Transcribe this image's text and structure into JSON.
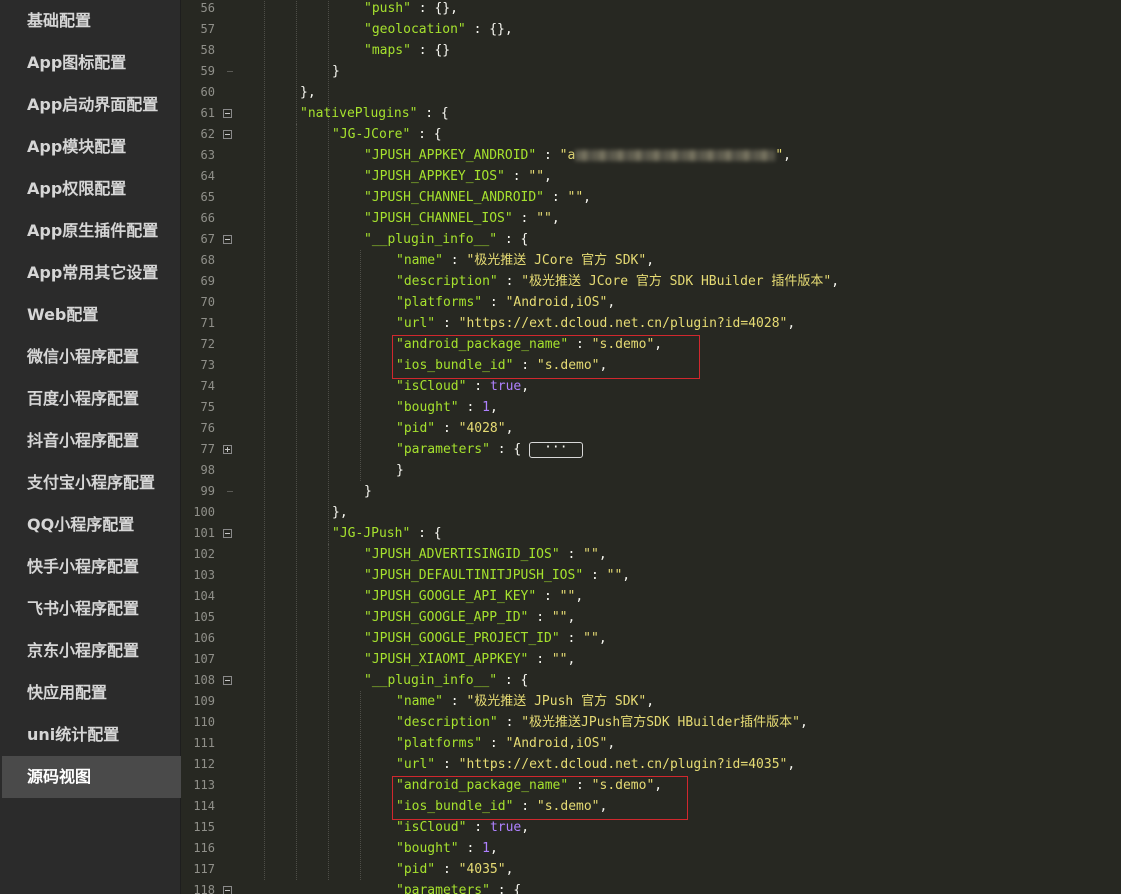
{
  "sidebar": {
    "items": [
      {
        "label": "基础配置"
      },
      {
        "label": "App图标配置"
      },
      {
        "label": "App启动界面配置"
      },
      {
        "label": "App模块配置"
      },
      {
        "label": "App权限配置"
      },
      {
        "label": "App原生插件配置"
      },
      {
        "label": "App常用其它设置"
      },
      {
        "label": "Web配置"
      },
      {
        "label": "微信小程序配置"
      },
      {
        "label": "百度小程序配置"
      },
      {
        "label": "抖音小程序配置"
      },
      {
        "label": "支付宝小程序配置"
      },
      {
        "label": "QQ小程序配置"
      },
      {
        "label": "快手小程序配置"
      },
      {
        "label": "飞书小程序配置"
      },
      {
        "label": "京东小程序配置"
      },
      {
        "label": "快应用配置"
      },
      {
        "label": "uni统计配置"
      },
      {
        "label": "源码视图",
        "active": true
      }
    ]
  },
  "editor": {
    "theme_colors": {
      "key": "#a6e22e",
      "string": "#e6db74",
      "number": "#ae81ff",
      "text": "#f8f8f2",
      "highlight": "#d0282e"
    },
    "lines": [
      {
        "no": "56",
        "indent": 3,
        "tokens": [
          [
            "k",
            "\"push\""
          ],
          [
            "p",
            " : {},"
          ]
        ]
      },
      {
        "no": "57",
        "indent": 3,
        "tokens": [
          [
            "k",
            "\"geolocation\""
          ],
          [
            "p",
            " : {},"
          ]
        ]
      },
      {
        "no": "58",
        "indent": 3,
        "tokens": [
          [
            "k",
            "\"maps\""
          ],
          [
            "p",
            " : {}"
          ]
        ]
      },
      {
        "no": "59",
        "indent": 2,
        "tokens": [
          [
            "p",
            "}"
          ]
        ],
        "fold": "end"
      },
      {
        "no": "60",
        "indent": 1,
        "tokens": [
          [
            "p",
            "},"
          ]
        ]
      },
      {
        "no": "61",
        "indent": 1,
        "tokens": [
          [
            "k",
            "\"nativePlugins\""
          ],
          [
            "p",
            " : {"
          ]
        ],
        "fold": "minus"
      },
      {
        "no": "62",
        "indent": 2,
        "tokens": [
          [
            "k",
            "\"JG-JCore\""
          ],
          [
            "p",
            " : {"
          ]
        ],
        "fold": "minus"
      },
      {
        "no": "63",
        "indent": 3,
        "tokens": [
          [
            "k",
            "\"JPUSH_APPKEY_ANDROID\""
          ],
          [
            "p",
            " : "
          ],
          [
            "s",
            "\"a"
          ],
          [
            "blur",
            ""
          ],
          [
            "s",
            "\""
          ],
          [
            "p",
            ","
          ]
        ]
      },
      {
        "no": "64",
        "indent": 3,
        "tokens": [
          [
            "k",
            "\"JPUSH_APPKEY_IOS\""
          ],
          [
            "p",
            " : "
          ],
          [
            "s",
            "\"\""
          ],
          [
            "p",
            ","
          ]
        ]
      },
      {
        "no": "65",
        "indent": 3,
        "tokens": [
          [
            "k",
            "\"JPUSH_CHANNEL_ANDROID\""
          ],
          [
            "p",
            " : "
          ],
          [
            "s",
            "\"\""
          ],
          [
            "p",
            ","
          ]
        ]
      },
      {
        "no": "66",
        "indent": 3,
        "tokens": [
          [
            "k",
            "\"JPUSH_CHANNEL_IOS\""
          ],
          [
            "p",
            " : "
          ],
          [
            "s",
            "\"\""
          ],
          [
            "p",
            ","
          ]
        ]
      },
      {
        "no": "67",
        "indent": 3,
        "tokens": [
          [
            "k",
            "\"__plugin_info__\""
          ],
          [
            "p",
            " : {"
          ]
        ],
        "fold": "minus"
      },
      {
        "no": "68",
        "indent": 4,
        "tokens": [
          [
            "k",
            "\"name\""
          ],
          [
            "p",
            " : "
          ],
          [
            "s",
            "\"极光推送 JCore 官方 SDK\""
          ],
          [
            "p",
            ","
          ]
        ]
      },
      {
        "no": "69",
        "indent": 4,
        "tokens": [
          [
            "k",
            "\"description\""
          ],
          [
            "p",
            " : "
          ],
          [
            "s",
            "\"极光推送 JCore 官方 SDK HBuilder 插件版本\""
          ],
          [
            "p",
            ","
          ]
        ]
      },
      {
        "no": "70",
        "indent": 4,
        "tokens": [
          [
            "k",
            "\"platforms\""
          ],
          [
            "p",
            " : "
          ],
          [
            "s",
            "\"Android,iOS\""
          ],
          [
            "p",
            ","
          ]
        ]
      },
      {
        "no": "71",
        "indent": 4,
        "tokens": [
          [
            "k",
            "\"url\""
          ],
          [
            "p",
            " : "
          ],
          [
            "s",
            "\"https://ext.dcloud.net.cn/plugin?id=4028\""
          ],
          [
            "p",
            ","
          ]
        ]
      },
      {
        "no": "72",
        "indent": 4,
        "tokens": [
          [
            "k",
            "\"android_package_name\""
          ],
          [
            "p",
            " : "
          ],
          [
            "s",
            "\"s.demo\""
          ],
          [
            "p",
            ","
          ]
        ]
      },
      {
        "no": "73",
        "indent": 4,
        "tokens": [
          [
            "k",
            "\"ios_bundle_id\""
          ],
          [
            "p",
            " : "
          ],
          [
            "s",
            "\"s.demo\""
          ],
          [
            "p",
            ","
          ]
        ]
      },
      {
        "no": "74",
        "indent": 4,
        "tokens": [
          [
            "k",
            "\"isCloud\""
          ],
          [
            "p",
            " : "
          ],
          [
            "n",
            "true"
          ],
          [
            "p",
            ","
          ]
        ]
      },
      {
        "no": "75",
        "indent": 4,
        "tokens": [
          [
            "k",
            "\"bought\""
          ],
          [
            "p",
            " : "
          ],
          [
            "n",
            "1"
          ],
          [
            "p",
            ","
          ]
        ]
      },
      {
        "no": "76",
        "indent": 4,
        "tokens": [
          [
            "k",
            "\"pid\""
          ],
          [
            "p",
            " : "
          ],
          [
            "s",
            "\"4028\""
          ],
          [
            "p",
            ","
          ]
        ]
      },
      {
        "no": "77",
        "indent": 4,
        "tokens": [
          [
            "k",
            "\"parameters\""
          ],
          [
            "p",
            " : { "
          ],
          [
            "folded",
            "···"
          ]
        ],
        "fold": "plus"
      },
      {
        "no": "98",
        "indent": 4,
        "tokens": [
          [
            "p",
            "}"
          ]
        ]
      },
      {
        "no": "99",
        "indent": 3,
        "tokens": [
          [
            "p",
            "}"
          ]
        ],
        "fold": "end"
      },
      {
        "no": "100",
        "indent": 2,
        "tokens": [
          [
            "p",
            "},"
          ]
        ]
      },
      {
        "no": "101",
        "indent": 2,
        "tokens": [
          [
            "k",
            "\"JG-JPush\""
          ],
          [
            "p",
            " : {"
          ]
        ],
        "fold": "minus"
      },
      {
        "no": "102",
        "indent": 3,
        "tokens": [
          [
            "k",
            "\"JPUSH_ADVERTISINGID_IOS\""
          ],
          [
            "p",
            " : "
          ],
          [
            "s",
            "\"\""
          ],
          [
            "p",
            ","
          ]
        ]
      },
      {
        "no": "103",
        "indent": 3,
        "tokens": [
          [
            "k",
            "\"JPUSH_DEFAULTINITJPUSH_IOS\""
          ],
          [
            "p",
            " : "
          ],
          [
            "s",
            "\"\""
          ],
          [
            "p",
            ","
          ]
        ]
      },
      {
        "no": "104",
        "indent": 3,
        "tokens": [
          [
            "k",
            "\"JPUSH_GOOGLE_API_KEY\""
          ],
          [
            "p",
            " : "
          ],
          [
            "s",
            "\"\""
          ],
          [
            "p",
            ","
          ]
        ]
      },
      {
        "no": "105",
        "indent": 3,
        "tokens": [
          [
            "k",
            "\"JPUSH_GOOGLE_APP_ID\""
          ],
          [
            "p",
            " : "
          ],
          [
            "s",
            "\"\""
          ],
          [
            "p",
            ","
          ]
        ]
      },
      {
        "no": "106",
        "indent": 3,
        "tokens": [
          [
            "k",
            "\"JPUSH_GOOGLE_PROJECT_ID\""
          ],
          [
            "p",
            " : "
          ],
          [
            "s",
            "\"\""
          ],
          [
            "p",
            ","
          ]
        ]
      },
      {
        "no": "107",
        "indent": 3,
        "tokens": [
          [
            "k",
            "\"JPUSH_XIAOMI_APPKEY\""
          ],
          [
            "p",
            " : "
          ],
          [
            "s",
            "\"\""
          ],
          [
            "p",
            ","
          ]
        ]
      },
      {
        "no": "108",
        "indent": 3,
        "tokens": [
          [
            "k",
            "\"__plugin_info__\""
          ],
          [
            "p",
            " : {"
          ]
        ],
        "fold": "minus"
      },
      {
        "no": "109",
        "indent": 4,
        "tokens": [
          [
            "k",
            "\"name\""
          ],
          [
            "p",
            " : "
          ],
          [
            "s",
            "\"极光推送 JPush 官方 SDK\""
          ],
          [
            "p",
            ","
          ]
        ]
      },
      {
        "no": "110",
        "indent": 4,
        "tokens": [
          [
            "k",
            "\"description\""
          ],
          [
            "p",
            " : "
          ],
          [
            "s",
            "\"极光推送JPush官方SDK HBuilder插件版本\""
          ],
          [
            "p",
            ","
          ]
        ]
      },
      {
        "no": "111",
        "indent": 4,
        "tokens": [
          [
            "k",
            "\"platforms\""
          ],
          [
            "p",
            " : "
          ],
          [
            "s",
            "\"Android,iOS\""
          ],
          [
            "p",
            ","
          ]
        ]
      },
      {
        "no": "112",
        "indent": 4,
        "tokens": [
          [
            "k",
            "\"url\""
          ],
          [
            "p",
            " : "
          ],
          [
            "s",
            "\"https://ext.dcloud.net.cn/plugin?id=4035\""
          ],
          [
            "p",
            ","
          ]
        ]
      },
      {
        "no": "113",
        "indent": 4,
        "tokens": [
          [
            "k",
            "\"android_package_name\""
          ],
          [
            "p",
            " : "
          ],
          [
            "s",
            "\"s.demo\""
          ],
          [
            "p",
            ","
          ]
        ]
      },
      {
        "no": "114",
        "indent": 4,
        "tokens": [
          [
            "k",
            "\"ios_bundle_id\""
          ],
          [
            "p",
            " : "
          ],
          [
            "s",
            "\"s.demo\""
          ],
          [
            "p",
            ","
          ]
        ]
      },
      {
        "no": "115",
        "indent": 4,
        "tokens": [
          [
            "k",
            "\"isCloud\""
          ],
          [
            "p",
            " : "
          ],
          [
            "n",
            "true"
          ],
          [
            "p",
            ","
          ]
        ]
      },
      {
        "no": "116",
        "indent": 4,
        "tokens": [
          [
            "k",
            "\"bought\""
          ],
          [
            "p",
            " : "
          ],
          [
            "n",
            "1"
          ],
          [
            "p",
            ","
          ]
        ]
      },
      {
        "no": "117",
        "indent": 4,
        "tokens": [
          [
            "k",
            "\"pid\""
          ],
          [
            "p",
            " : "
          ],
          [
            "s",
            "\"4035\""
          ],
          [
            "p",
            ","
          ]
        ]
      },
      {
        "no": "118",
        "indent": 4,
        "tokens": [
          [
            "k",
            "\"parameters\""
          ],
          [
            "p",
            " : {"
          ]
        ],
        "fold": "minus"
      }
    ]
  }
}
